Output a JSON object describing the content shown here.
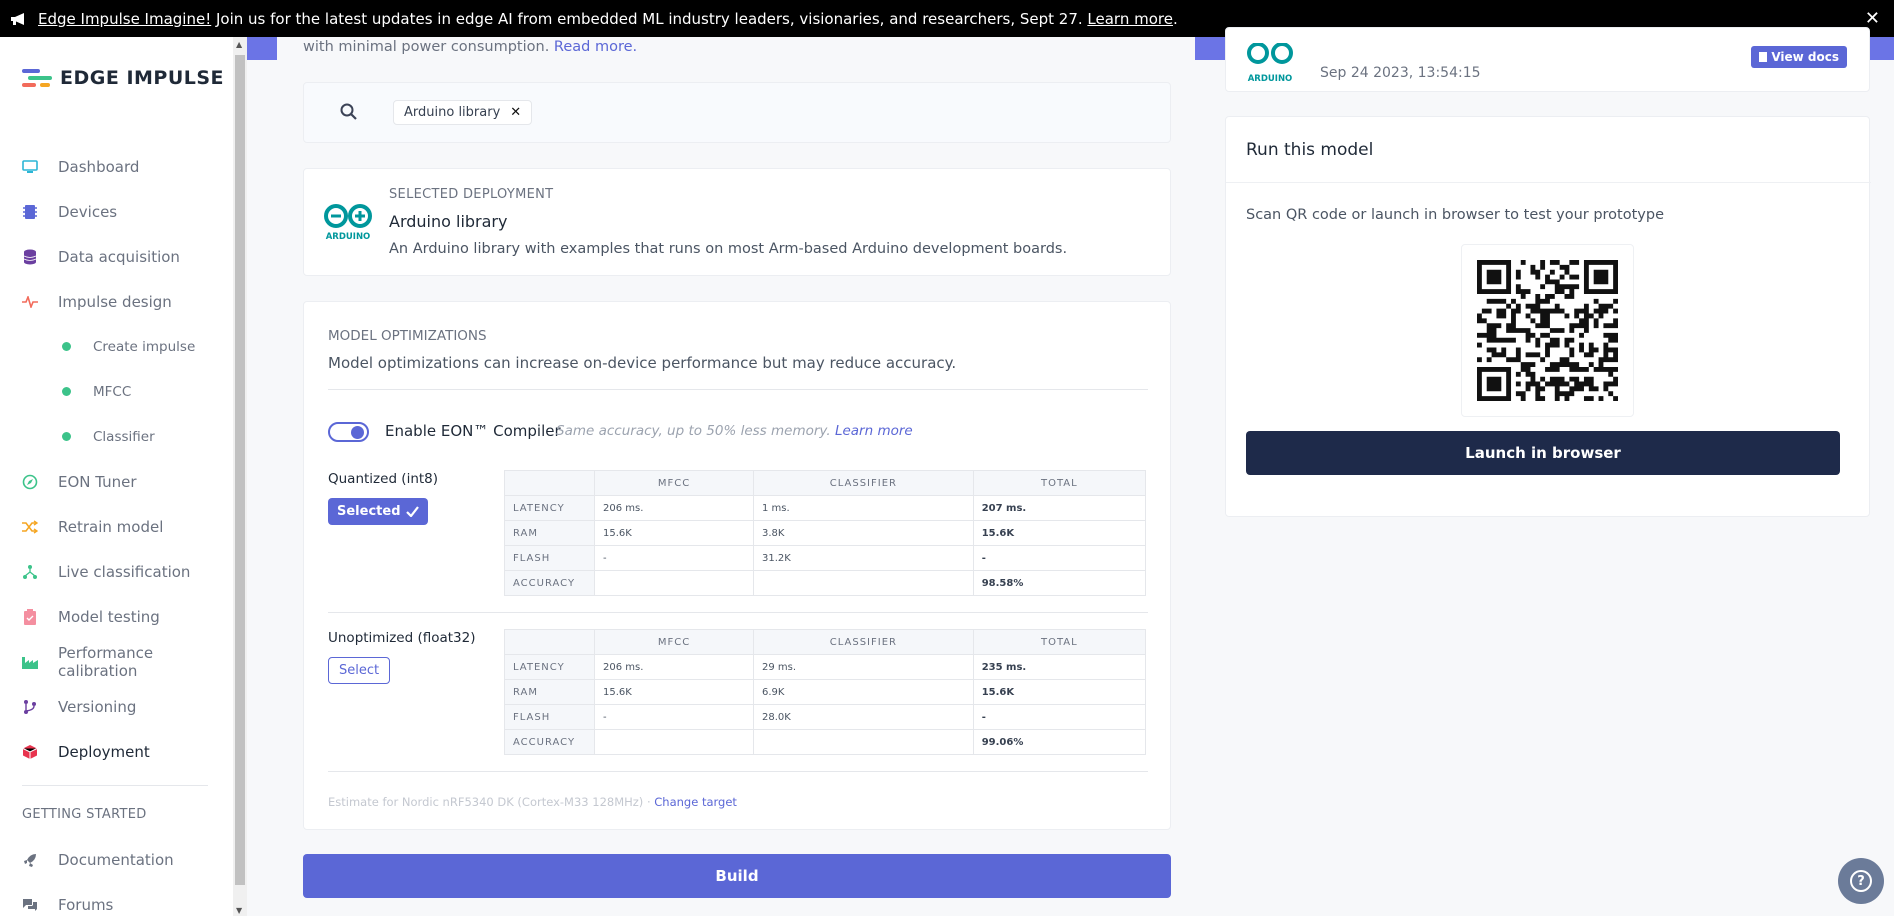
{
  "banner": {
    "link1": "Edge Impulse Imagine!",
    "text": " Join us for the latest updates in edge AI from embedded ML industry leaders, visionaries, and researchers, Sept 27. ",
    "link2": "Learn more",
    "end": ".",
    "close": "✕"
  },
  "brand": {
    "name": "EDGE IMPULSE"
  },
  "sidebar": {
    "items": [
      {
        "label": "Dashboard",
        "icon": "monitor-icon"
      },
      {
        "label": "Devices",
        "icon": "chip-icon"
      },
      {
        "label": "Data acquisition",
        "icon": "database-icon"
      },
      {
        "label": "Impulse design",
        "icon": "pulse-icon"
      },
      {
        "label": "Create impulse",
        "icon": "dot-icon"
      },
      {
        "label": "MFCC",
        "icon": "dot-icon"
      },
      {
        "label": "Classifier",
        "icon": "dot-icon"
      },
      {
        "label": "EON Tuner",
        "icon": "compass-icon"
      },
      {
        "label": "Retrain model",
        "icon": "shuffle-icon"
      },
      {
        "label": "Live classification",
        "icon": "tree-icon"
      },
      {
        "label": "Model testing",
        "icon": "clipboard-icon"
      },
      {
        "label": "Performance calibration",
        "icon": "factory-icon"
      },
      {
        "label": "Versioning",
        "icon": "branch-icon"
      },
      {
        "label": "Deployment",
        "icon": "box-icon"
      }
    ],
    "section_title": "GETTING STARTED",
    "getting_started": [
      {
        "label": "Documentation",
        "icon": "rocket-icon"
      },
      {
        "label": "Forums",
        "icon": "chat-icon"
      }
    ]
  },
  "main": {
    "intro": "with minimal power consumption. ",
    "intro_link": "Read more.",
    "search_chip": "Arduino library",
    "chip_close": "✕",
    "selected_label": "SELECTED DEPLOYMENT",
    "selected_name": "Arduino library",
    "selected_desc": "An Arduino library with examples that runs on most Arm-based Arduino development boards.",
    "arduino_logo_text": "ARDUINO",
    "opt_title": "MODEL OPTIMIZATIONS",
    "opt_sub": "Model optimizations can increase on-device performance but may reduce accuracy.",
    "eon_label": "Enable EON™ Compiler",
    "eon_note": "Same accuracy, up to 50% less memory. ",
    "eon_link": "Learn more",
    "quantized": {
      "label": "Quantized (int8)",
      "button": "Selected",
      "headers": [
        "",
        "MFCC",
        "CLASSIFIER",
        "TOTAL"
      ],
      "rows": [
        [
          "LATENCY",
          "206 ms.",
          "1 ms.",
          "207 ms."
        ],
        [
          "RAM",
          "15.6K",
          "3.8K",
          "15.6K"
        ],
        [
          "FLASH",
          "-",
          "31.2K",
          "-"
        ],
        [
          "ACCURACY",
          "",
          "",
          "98.58%"
        ]
      ]
    },
    "unoptimized": {
      "label": "Unoptimized (float32)",
      "button": "Select",
      "headers": [
        "",
        "MFCC",
        "CLASSIFIER",
        "TOTAL"
      ],
      "rows": [
        [
          "LATENCY",
          "206 ms.",
          "29 ms.",
          "235 ms."
        ],
        [
          "RAM",
          "15.6K",
          "6.9K",
          "15.6K"
        ],
        [
          "FLASH",
          "-",
          "28.0K",
          "-"
        ],
        [
          "ACCURACY",
          "",
          "",
          "99.06%"
        ]
      ]
    },
    "estimate": "Estimate for Nordic nRF5340 DK (Cortex-M33 128MHz) · ",
    "estimate_link": "Change target",
    "build": "Build"
  },
  "right": {
    "date": "Sep 24 2023, 13:54:15",
    "docs": "View docs",
    "run_title": "Run this model",
    "hint": "Scan QR code or launch in browser to test your prototype",
    "launch": "Launch in browser"
  },
  "help": "?",
  "colors": {
    "accent": "#5b67d6",
    "dark": "#1e2a4a",
    "green": "#3cc38a",
    "arduino": "#00979c"
  }
}
